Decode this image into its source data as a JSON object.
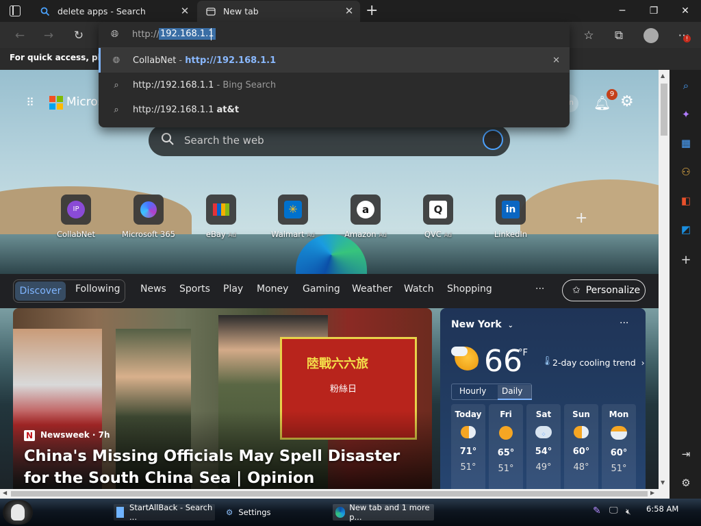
{
  "tabs": [
    {
      "title": "delete apps - Search",
      "icon": "search-icon"
    },
    {
      "title": "New tab",
      "icon": "new-tab-icon"
    }
  ],
  "address": {
    "scheme": "http://",
    "selected": "192.168.1.1"
  },
  "suggestions": [
    {
      "icon": "globe-icon",
      "name": "CollabNet",
      "sep": " - ",
      "url": "http://192.168.1.1"
    },
    {
      "icon": "search-icon",
      "query": "http://192.168.1.1",
      "suffix": " - Bing Search"
    },
    {
      "icon": "search-icon",
      "query": "http://192.168.1.1",
      "bold": "at&t"
    }
  ],
  "infobar": {
    "text": "For quick access, place y"
  },
  "ntp": {
    "brand": "Micros",
    "signin": "in",
    "notification_count": "9",
    "search_placeholder": "Search the web",
    "quicklinks": [
      {
        "label": "CollabNet",
        "ad": "",
        "icon": "ip-icon"
      },
      {
        "label": "Microsoft 365",
        "ad": "",
        "icon": "microsoft-365-icon"
      },
      {
        "label": "eBay",
        "ad": "Ad",
        "icon": "ebay-icon"
      },
      {
        "label": "Walmart",
        "ad": "Ad",
        "icon": "walmart-icon"
      },
      {
        "label": "Amazon",
        "ad": "Ad",
        "icon": "amazon-icon"
      },
      {
        "label": "QVC",
        "ad": "Ad",
        "icon": "qvc-icon"
      },
      {
        "label": "LinkedIn",
        "ad": "",
        "icon": "linkedin-icon"
      }
    ],
    "feed_tabs": [
      "Discover",
      "Following"
    ],
    "nav": [
      "News",
      "Sports",
      "Play",
      "Money",
      "Gaming",
      "Weather",
      "Watch",
      "Shopping"
    ],
    "more": "···",
    "personalize": "Personalize"
  },
  "article": {
    "source_logo": "N",
    "source": "Newsweek · 7h",
    "headline": "China's Missing Officials May Spell Disaster for the South China Sea | Opinion",
    "sign_text": "陸戰六六旅",
    "sign_text2": "粉絲日"
  },
  "weather": {
    "location": "New York",
    "more": "···",
    "temp": "66",
    "unit": "°F",
    "trend": "2-day cooling trend",
    "tabs": [
      "Hourly",
      "Daily"
    ],
    "days": [
      {
        "d": "Today",
        "hi": "71°",
        "lo": "51°",
        "icon": "partly-cloudy-icon"
      },
      {
        "d": "Fri",
        "hi": "65°",
        "lo": "51°",
        "icon": "sunny-icon"
      },
      {
        "d": "Sat",
        "hi": "54°",
        "lo": "49°",
        "icon": "rain-icon"
      },
      {
        "d": "Sun",
        "hi": "60°",
        "lo": "48°",
        "icon": "partly-cloudy-icon"
      },
      {
        "d": "Mon",
        "hi": "60°",
        "lo": "51°",
        "icon": "cloudy-sun-icon"
      }
    ]
  },
  "taskbar": {
    "items": [
      "StartAllBack - Search ...",
      "Settings",
      "New tab and 1 more p..."
    ],
    "clock": "6:58 AM"
  }
}
